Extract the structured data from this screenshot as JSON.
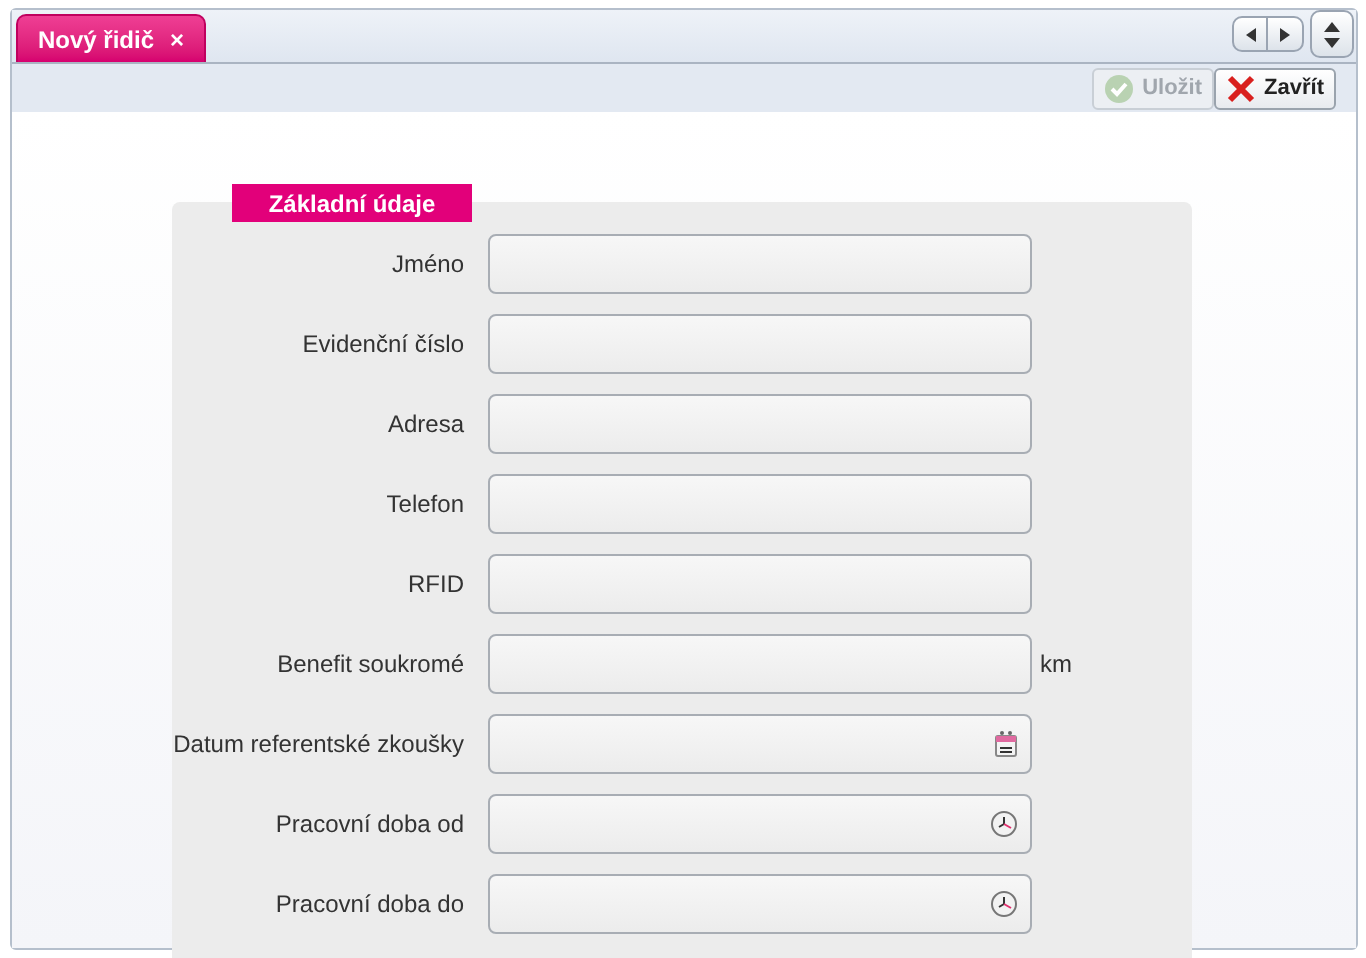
{
  "tabs": [
    {
      "label": "Nový řidič",
      "close": "×",
      "selected": true
    }
  ],
  "toolbar": [
    {
      "kind": "save",
      "label": "Uložit",
      "disabled": true
    },
    {
      "kind": "close",
      "label": "Zavřít",
      "disabled": false
    }
  ],
  "section": {
    "title": "Základní údaje",
    "fields": [
      {
        "kind": "text",
        "label": "Jméno"
      },
      {
        "kind": "text",
        "label": "Evidenční číslo"
      },
      {
        "kind": "text",
        "label": "Adresa"
      },
      {
        "kind": "text",
        "label": "Telefon"
      },
      {
        "kind": "text",
        "label": "RFID"
      },
      {
        "kind": "text",
        "label": "Benefit soukromé",
        "unit": "km"
      },
      {
        "kind": "date",
        "label": "Datum referentské zkoušky"
      },
      {
        "kind": "time",
        "label": "Pracovní doba od"
      },
      {
        "kind": "time",
        "label": "Pracovní doba do"
      }
    ]
  }
}
